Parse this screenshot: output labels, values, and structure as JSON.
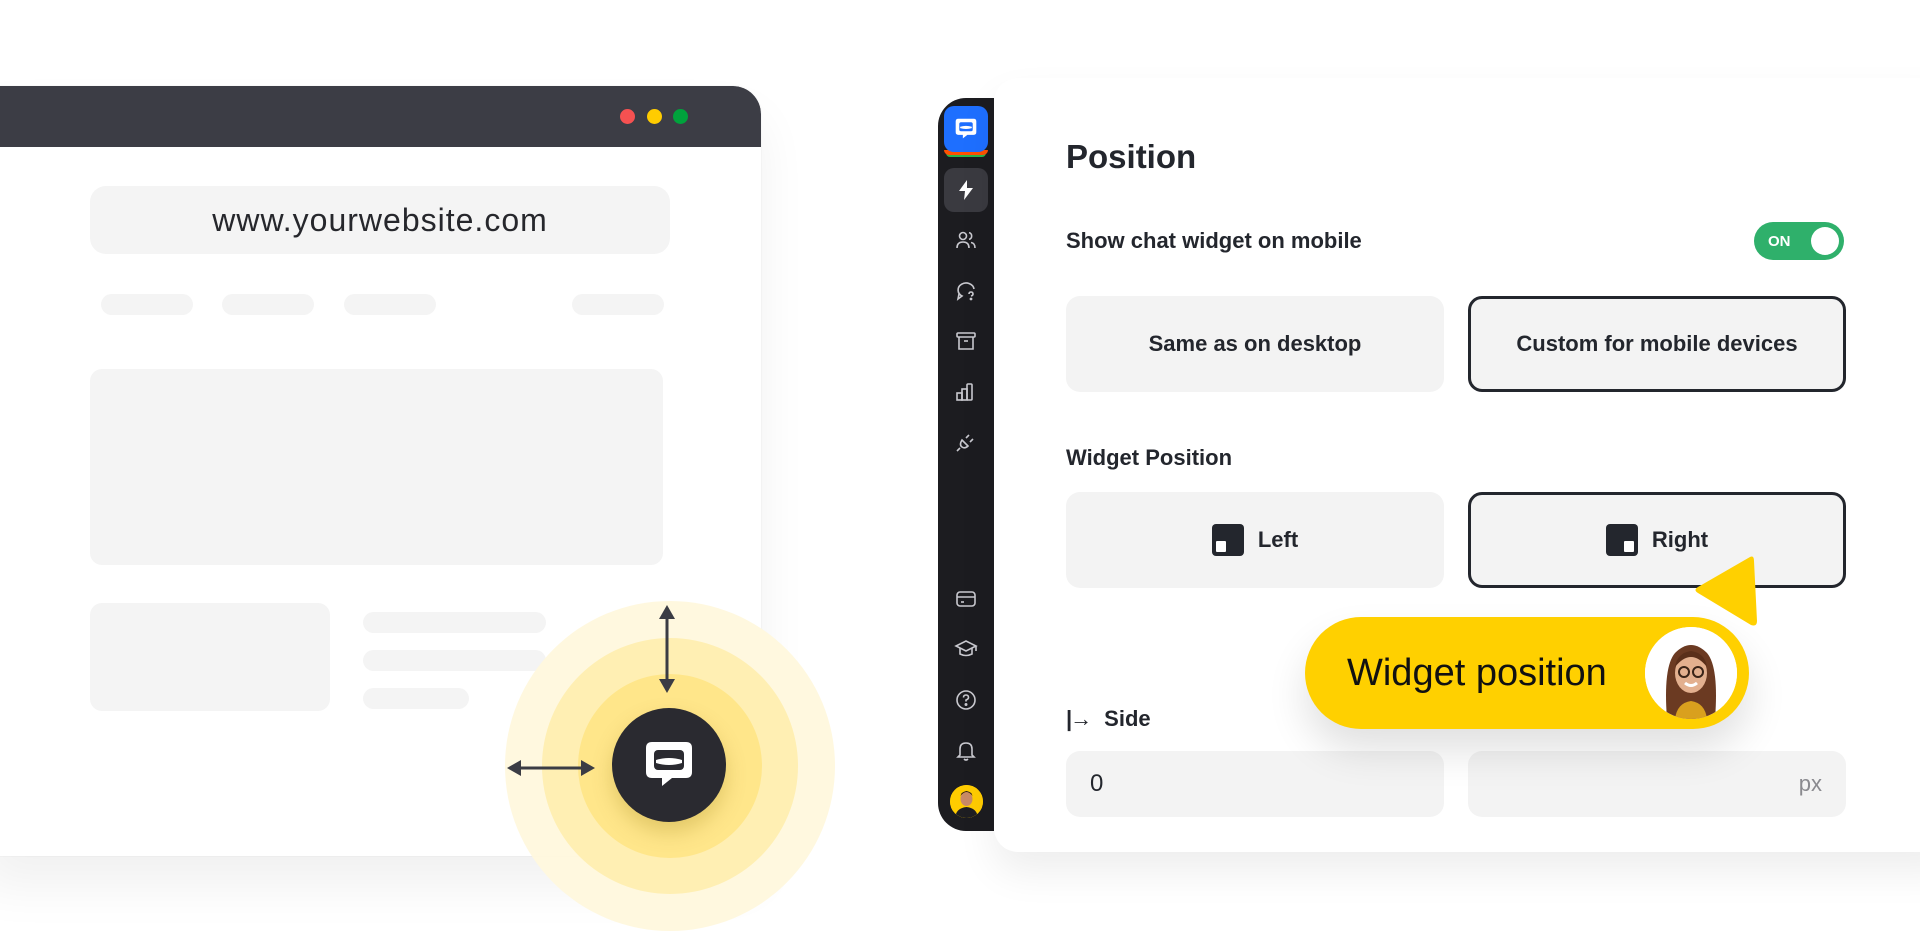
{
  "browser": {
    "url": "www.yourwebsite.com",
    "window_controls": [
      "close",
      "minimize",
      "maximize"
    ],
    "window_control_colors": {
      "close": "#f65151",
      "minimize": "#ffcc00",
      "maximize": "#00a33c"
    }
  },
  "widget_preview": {
    "icon": "chat-bubble-icon",
    "accent": "#ffd000"
  },
  "sidebar": {
    "logo": "livechat-logo",
    "items": [
      {
        "name": "automation",
        "icon": "lightning-icon",
        "active": true
      },
      {
        "name": "agents",
        "icon": "users-icon",
        "active": false
      },
      {
        "name": "chats",
        "icon": "chat-question-icon",
        "active": false
      },
      {
        "name": "archives",
        "icon": "archive-icon",
        "active": false
      },
      {
        "name": "reports",
        "icon": "bar-chart-icon",
        "active": false
      },
      {
        "name": "integrations",
        "icon": "plug-icon",
        "active": false
      }
    ],
    "bottom_items": [
      {
        "name": "billing",
        "icon": "credit-card-icon"
      },
      {
        "name": "learning",
        "icon": "graduation-cap-icon"
      },
      {
        "name": "help",
        "icon": "help-icon"
      },
      {
        "name": "notifications",
        "icon": "bell-icon"
      }
    ]
  },
  "settings": {
    "title": "Position",
    "mobile_toggle": {
      "label": "Show chat widget on mobile",
      "state": "ON",
      "color": "#2fb06b"
    },
    "mobile_options": [
      {
        "label": "Same as on desktop",
        "selected": false
      },
      {
        "label": "Custom for mobile devices",
        "selected": true
      }
    ],
    "widget_position": {
      "label": "Widget Position",
      "options": [
        {
          "label": "Left",
          "selected": false
        },
        {
          "label": "Right",
          "selected": true
        }
      ]
    },
    "side": {
      "label": "Side",
      "value": "0",
      "unit": "px"
    }
  },
  "tooltip": {
    "text": "Widget position",
    "color": "#ffd000"
  }
}
